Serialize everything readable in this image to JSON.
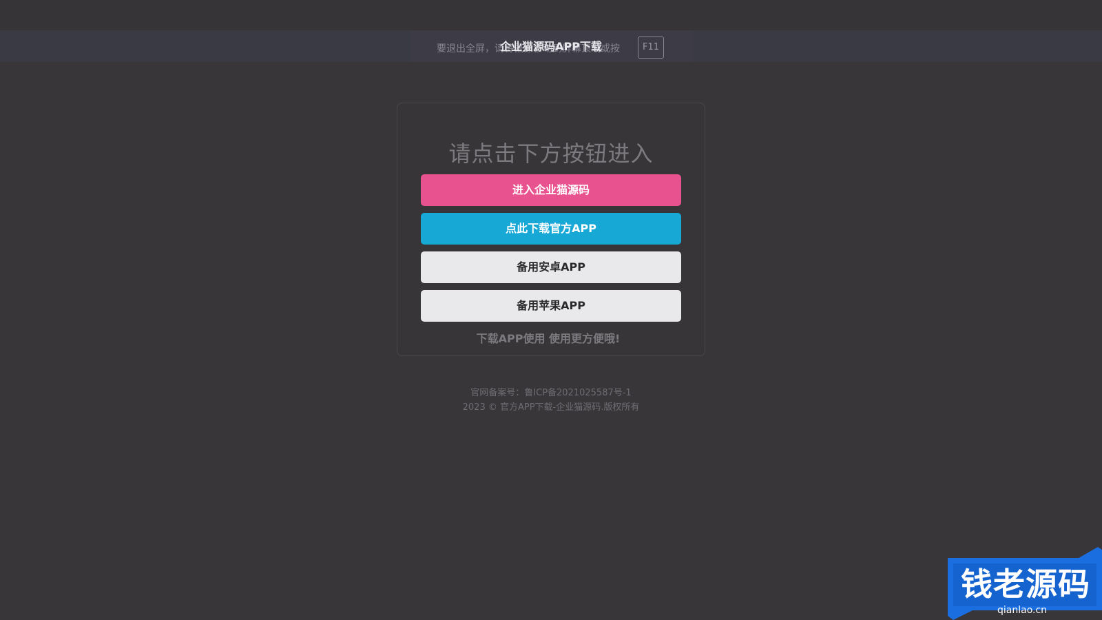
{
  "browser": {
    "page_title": "企业猫源码APP下载",
    "fullscreen_hint": "要退出全屏，请将鼠标移动到屏幕顶端或按",
    "fullscreen_key": "F11"
  },
  "card": {
    "heading": "请点击下方按钮进入",
    "buttons": {
      "enter": "进入企业猫源码",
      "download": "点此下载官方APP",
      "android": "备用安卓APP",
      "apple": "备用苹果APP"
    },
    "tip": "下载APP使用 使用更方便哦!"
  },
  "footer": {
    "icp": "官网备案号：鲁ICP备2021025587号-1",
    "copyright": "2023 © 官方APP下载-企业猫源码.版权所有"
  },
  "watermark": {
    "text": "钱老源码",
    "url": "qianlao.cn"
  },
  "colors": {
    "background": "#393639",
    "enter_button": "#e8528e",
    "download_button": "#17a8d6",
    "backup_button": "#e9e8ea",
    "watermark_blue": "#1a6ee0"
  }
}
